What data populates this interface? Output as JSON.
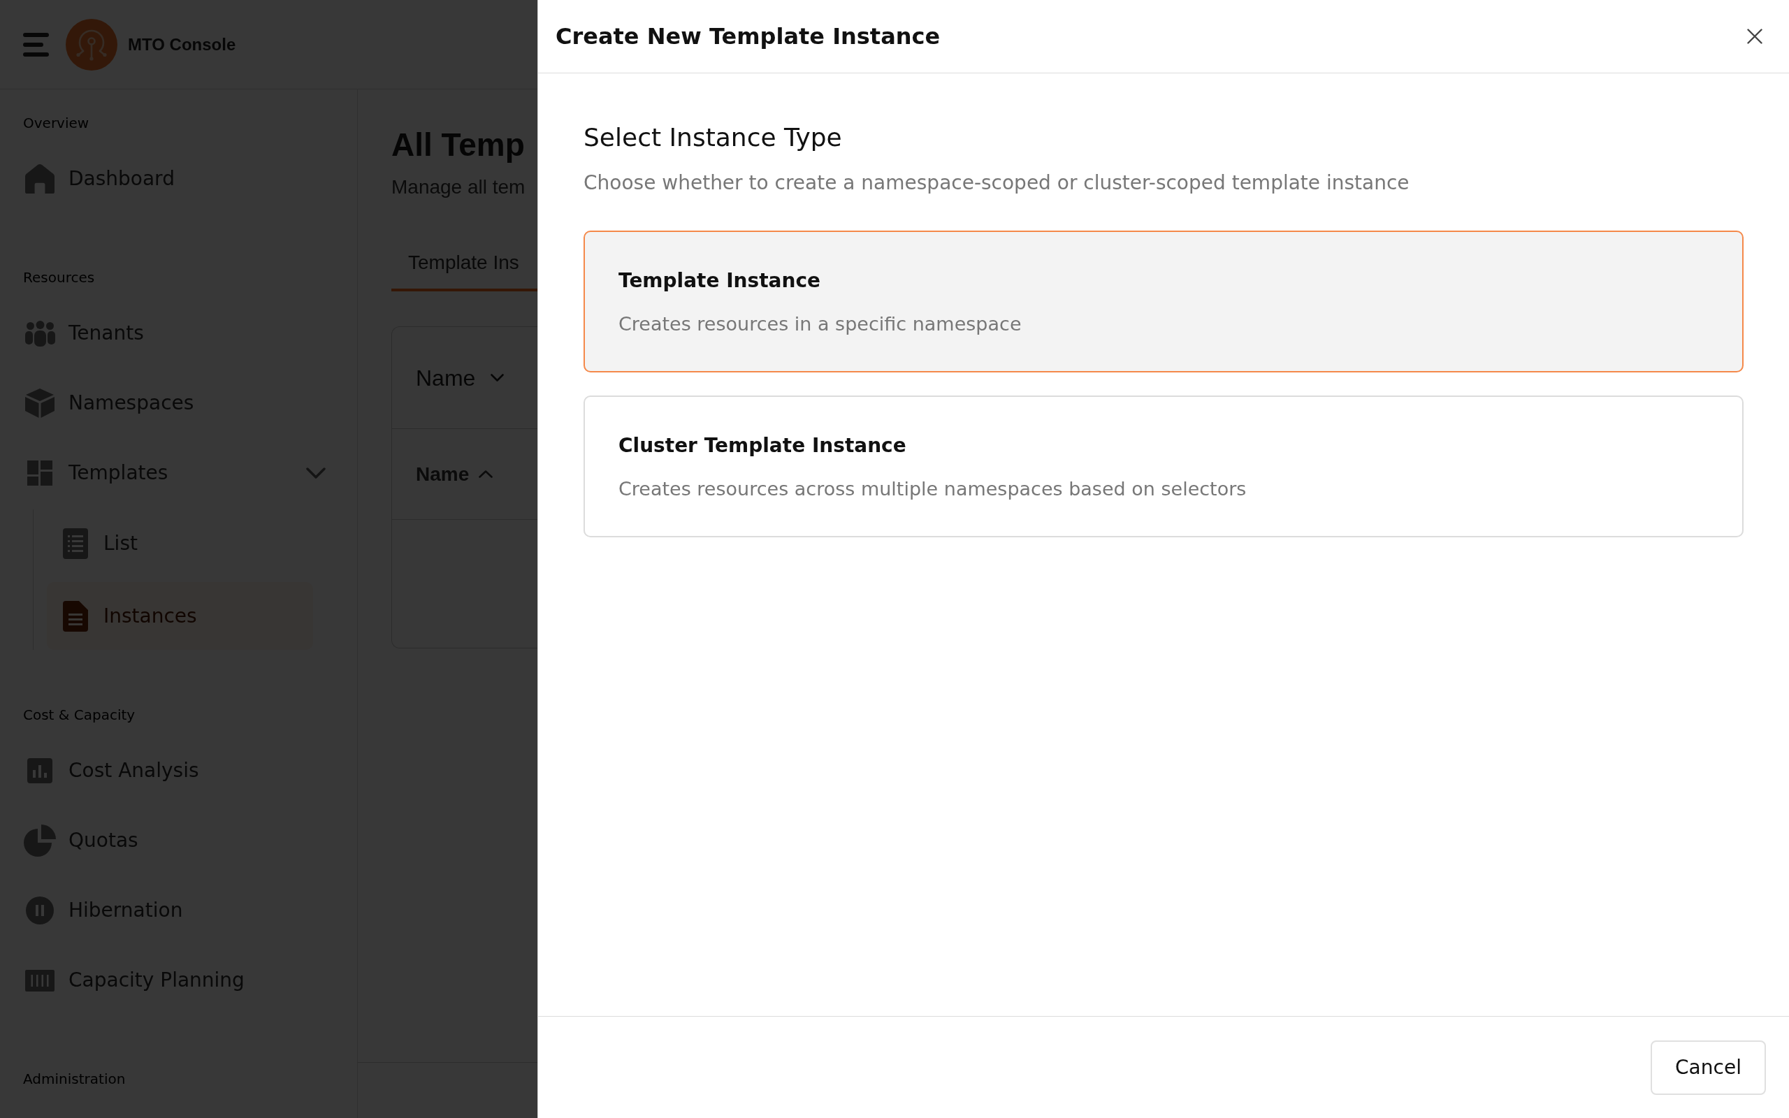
{
  "app": {
    "title": "MTO Console"
  },
  "sidebar": {
    "sections": [
      {
        "label": "Overview",
        "items": [
          {
            "label": "Dashboard",
            "selected": false
          }
        ]
      },
      {
        "label": "Resources",
        "items": [
          {
            "label": "Tenants",
            "selected": false
          },
          {
            "label": "Namespaces",
            "selected": false
          },
          {
            "label": "Templates",
            "selected": false,
            "expanded": true,
            "children": [
              {
                "label": "List",
                "selected": false
              },
              {
                "label": "Instances",
                "selected": true
              }
            ]
          }
        ]
      },
      {
        "label": "Cost & Capacity",
        "items": [
          {
            "label": "Cost Analysis",
            "selected": false
          },
          {
            "label": "Quotas",
            "selected": false
          },
          {
            "label": "Hibernation",
            "selected": false
          },
          {
            "label": "Capacity Planning",
            "selected": false
          }
        ]
      },
      {
        "label": "Administration"
      }
    ]
  },
  "page": {
    "title": "All Temp",
    "subtitle": "Manage all tem",
    "tabs": [
      {
        "label": "Template Ins",
        "selected": true
      }
    ],
    "table": {
      "filter": {
        "label": "Name"
      },
      "columns": [
        {
          "label": "Name",
          "sorted_ascending": true
        }
      ]
    }
  },
  "dialog": {
    "title": "Create New Template Instance",
    "heading": "Select Instance Type",
    "description": "Choose whether to create a namespace-scoped or cluster-scoped template instance",
    "options": [
      {
        "title": "Template Instance",
        "description": "Creates resources in a specific namespace",
        "selected": true
      },
      {
        "title": "Cluster Template Instance",
        "description": "Creates resources across multiple namespaces based on selectors",
        "selected": false
      }
    ],
    "buttons": [
      "Cancel"
    ]
  }
}
